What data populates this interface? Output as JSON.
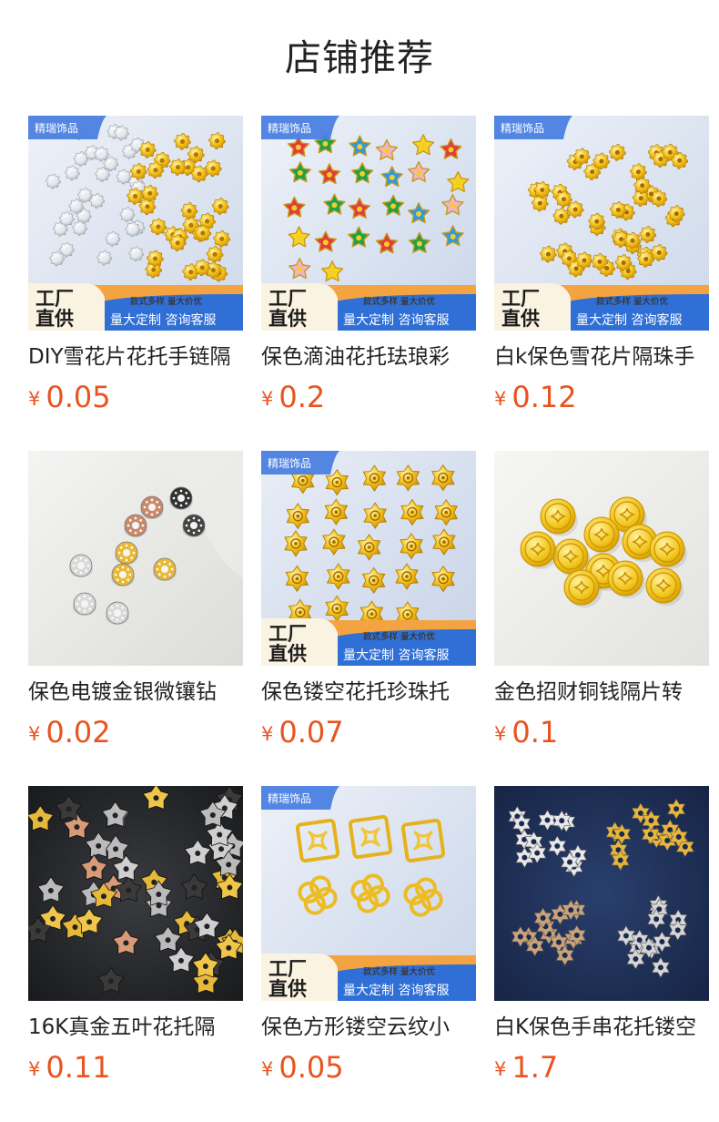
{
  "header": {
    "title": "店铺推荐"
  },
  "currency_symbol": "¥",
  "badges": {
    "shop_tag": "精瑞饰品",
    "factory_line1": "工厂",
    "factory_line2": "直供",
    "promo_small": "款式多样 量大价优",
    "promo_large": "量大定制 咨询客服"
  },
  "products": [
    {
      "name": "DIY雪花片花托手链隔",
      "price": "0.05",
      "image": "silver-gold-snowflake-spacers",
      "banner": true
    },
    {
      "name": "保色滴油花托珐琅彩",
      "price": "0.2",
      "image": "enamel-flower-caps",
      "banner": true
    },
    {
      "name": "白k保色雪花片隔珠手",
      "price": "0.12",
      "image": "gold-snowflake-spacers",
      "banner": true
    },
    {
      "name": "保色电镀金银微镶钻",
      "price": "0.02",
      "image": "rhinestone-rondelles",
      "banner": false
    },
    {
      "name": "保色镂空花托珍珠托",
      "price": "0.07",
      "image": "gold-filigree-flower-caps",
      "banner": true
    },
    {
      "name": "金色招财铜钱隔片转",
      "price": "0.1",
      "image": "gold-coin-spacers",
      "banner": false
    },
    {
      "name": "16K真金五叶花托隔",
      "price": "0.11",
      "image": "five-petal-bead-caps",
      "banner": false
    },
    {
      "name": "保色方形镂空云纹小",
      "price": "0.05",
      "image": "square-cloud-pattern-charms",
      "banner": true
    },
    {
      "name": "白K保色手串花托镂空",
      "price": "1.7",
      "image": "filigree-flower-caps-navy",
      "banner": false
    }
  ]
}
